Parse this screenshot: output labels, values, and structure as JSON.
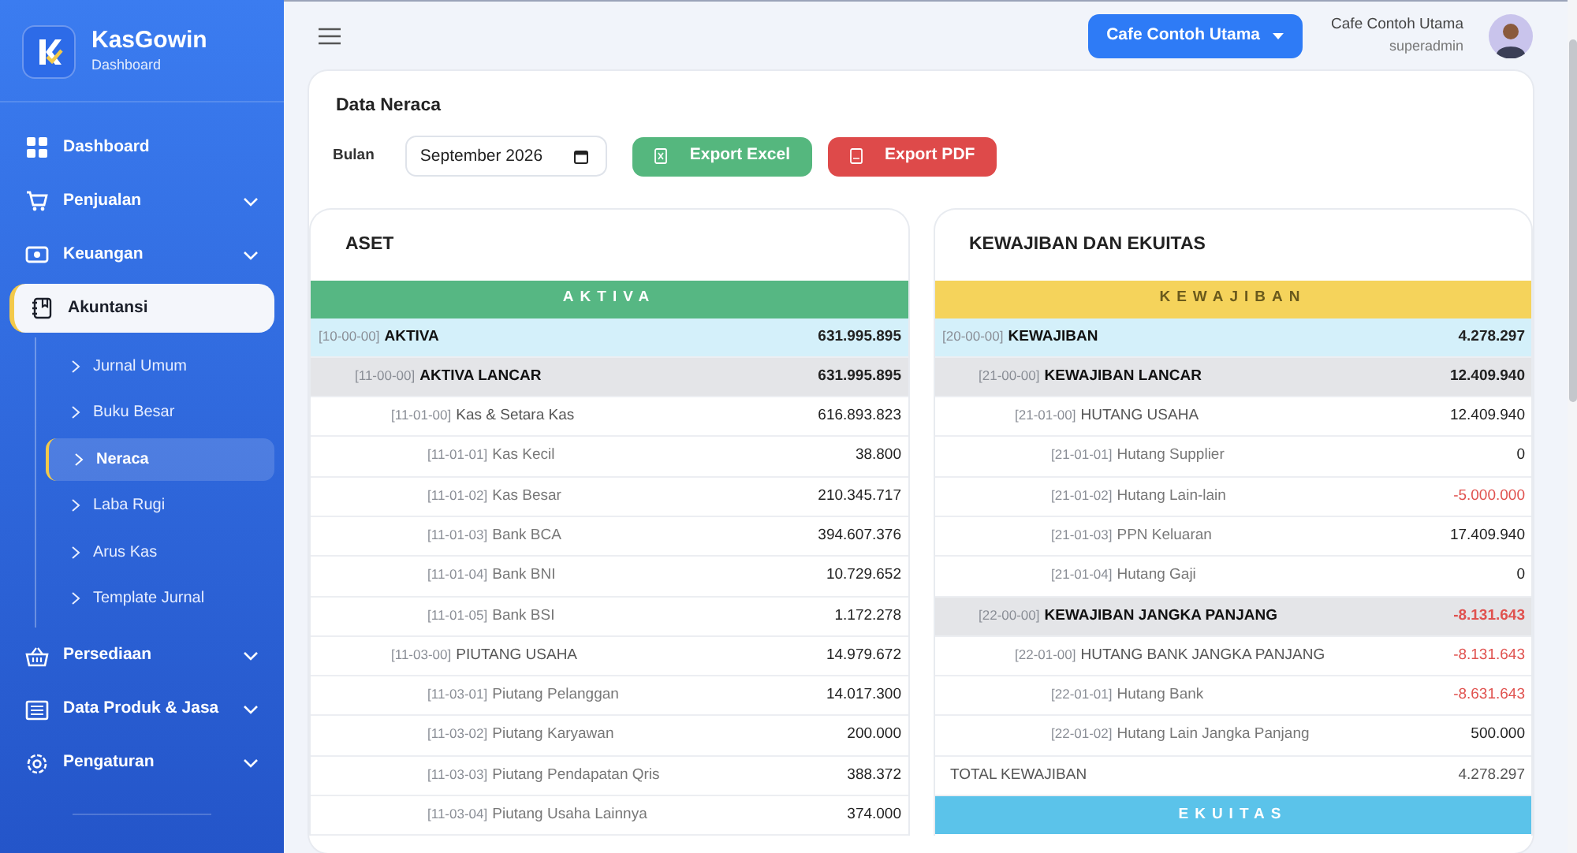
{
  "brand": {
    "name": "KasGowin",
    "subtitle": "Dashboard"
  },
  "sidebar": {
    "items": [
      {
        "label": "Dashboard",
        "kind": "link",
        "selected": false
      },
      {
        "label": "Penjualan",
        "kind": "menu",
        "expanded": false,
        "selected": false
      },
      {
        "label": "Keuangan",
        "kind": "menu",
        "expanded": false,
        "selected": false
      },
      {
        "label": "Akuntansi",
        "kind": "menu",
        "expanded": true,
        "selected": true,
        "children": [
          {
            "label": "Jurnal Umum",
            "selected": false
          },
          {
            "label": "Buku Besar",
            "selected": false
          },
          {
            "label": "Neraca",
            "selected": true
          },
          {
            "label": "Laba Rugi",
            "selected": false
          },
          {
            "label": "Arus Kas",
            "selected": false
          },
          {
            "label": "Template Jurnal",
            "selected": false
          }
        ]
      },
      {
        "label": "Persediaan",
        "kind": "menu",
        "expanded": false,
        "selected": false
      },
      {
        "label": "Data Produk & Jasa",
        "kind": "menu",
        "expanded": false,
        "selected": false
      },
      {
        "label": "Pengaturan",
        "kind": "menu",
        "expanded": false,
        "selected": false
      }
    ]
  },
  "topbar": {
    "outlet_button": "Cafe Contoh Utama",
    "user_name": "Cafe Contoh Utama",
    "user_role": "superadmin"
  },
  "page": {
    "title": "Data Neraca",
    "month_label": "Bulan",
    "month_value": "September 2026",
    "buttons": [
      {
        "label": "Export Excel",
        "kind": "excel"
      },
      {
        "label": "Export PDF",
        "kind": "pdf"
      }
    ]
  },
  "panels": [
    {
      "title": "ASET",
      "sections": [
        {
          "banner": "AKTIVA",
          "color": "#56b783",
          "rows": [
            {
              "code": "[10-00-00]",
              "name": "AKTIVA",
              "amount": "631.995.895",
              "negative": false,
              "children": [
                {
                  "code": "[11-00-00]",
                  "name": "AKTIVA LANCAR",
                  "amount": "631.995.895",
                  "negative": false,
                  "children": [
                    {
                      "code": "[11-01-00]",
                      "name": "Kas & Setara Kas",
                      "amount": "616.893.823",
                      "negative": false,
                      "children": [
                        {
                          "code": "[11-01-01]",
                          "name": "Kas Kecil",
                          "amount": "38.800",
                          "negative": false
                        },
                        {
                          "code": "[11-01-02]",
                          "name": "Kas Besar",
                          "amount": "210.345.717",
                          "negative": false
                        },
                        {
                          "code": "[11-01-03]",
                          "name": "Bank BCA",
                          "amount": "394.607.376",
                          "negative": false
                        },
                        {
                          "code": "[11-01-04]",
                          "name": "Bank BNI",
                          "amount": "10.729.652",
                          "negative": false
                        },
                        {
                          "code": "[11-01-05]",
                          "name": "Bank BSI",
                          "amount": "1.172.278",
                          "negative": false
                        }
                      ]
                    },
                    {
                      "code": "[11-03-00]",
                      "name": "PIUTANG USAHA",
                      "amount": "14.979.672",
                      "negative": false,
                      "children": [
                        {
                          "code": "[11-03-01]",
                          "name": "Piutang Pelanggan",
                          "amount": "14.017.300",
                          "negative": false
                        },
                        {
                          "code": "[11-03-02]",
                          "name": "Piutang Karyawan",
                          "amount": "200.000",
                          "negative": false
                        },
                        {
                          "code": "[11-03-03]",
                          "name": "Piutang Pendapatan Qris",
                          "amount": "388.372",
                          "negative": false
                        },
                        {
                          "code": "[11-03-04]",
                          "name": "Piutang Usaha Lainnya",
                          "amount": "374.000",
                          "negative": false
                        }
                      ]
                    }
                  ]
                }
              ]
            }
          ]
        }
      ]
    },
    {
      "title": "KEWAJIBAN DAN EKUITAS",
      "sections": [
        {
          "banner": "KEWAJIBAN",
          "color": "#f5d35b",
          "rows": [
            {
              "code": "[20-00-00]",
              "name": "KEWAJIBAN",
              "amount": "4.278.297",
              "negative": false,
              "children": [
                {
                  "code": "[21-00-00]",
                  "name": "KEWAJIBAN LANCAR",
                  "amount": "12.409.940",
                  "negative": false,
                  "children": [
                    {
                      "code": "[21-01-00]",
                      "name": "HUTANG USAHA",
                      "amount": "12.409.940",
                      "negative": false,
                      "children": [
                        {
                          "code": "[21-01-01]",
                          "name": "Hutang Supplier",
                          "amount": "0",
                          "negative": false
                        },
                        {
                          "code": "[21-01-02]",
                          "name": "Hutang Lain-lain",
                          "amount": "-5.000.000",
                          "negative": true
                        },
                        {
                          "code": "[21-01-03]",
                          "name": "PPN Keluaran",
                          "amount": "17.409.940",
                          "negative": false
                        },
                        {
                          "code": "[21-01-04]",
                          "name": "Hutang Gaji",
                          "amount": "0",
                          "negative": false
                        }
                      ]
                    }
                  ]
                },
                {
                  "code": "[22-00-00]",
                  "name": "KEWAJIBAN JANGKA PANJANG",
                  "amount": "-8.131.643",
                  "negative": true,
                  "children": [
                    {
                      "code": "[22-01-00]",
                      "name": "HUTANG BANK JANGKA PANJANG",
                      "amount": "-8.131.643",
                      "negative": true,
                      "children": [
                        {
                          "code": "[22-01-01]",
                          "name": "Hutang Bank",
                          "amount": "-8.631.643",
                          "negative": true
                        },
                        {
                          "code": "[22-01-02]",
                          "name": "Hutang Lain Jangka Panjang",
                          "amount": "500.000",
                          "negative": false
                        }
                      ]
                    }
                  ]
                }
              ]
            }
          ],
          "total": {
            "label": "TOTAL KEWAJIBAN",
            "amount": "4.278.297"
          }
        },
        {
          "banner": "EKUITAS",
          "color": "#5bc3ea"
        }
      ]
    }
  ]
}
